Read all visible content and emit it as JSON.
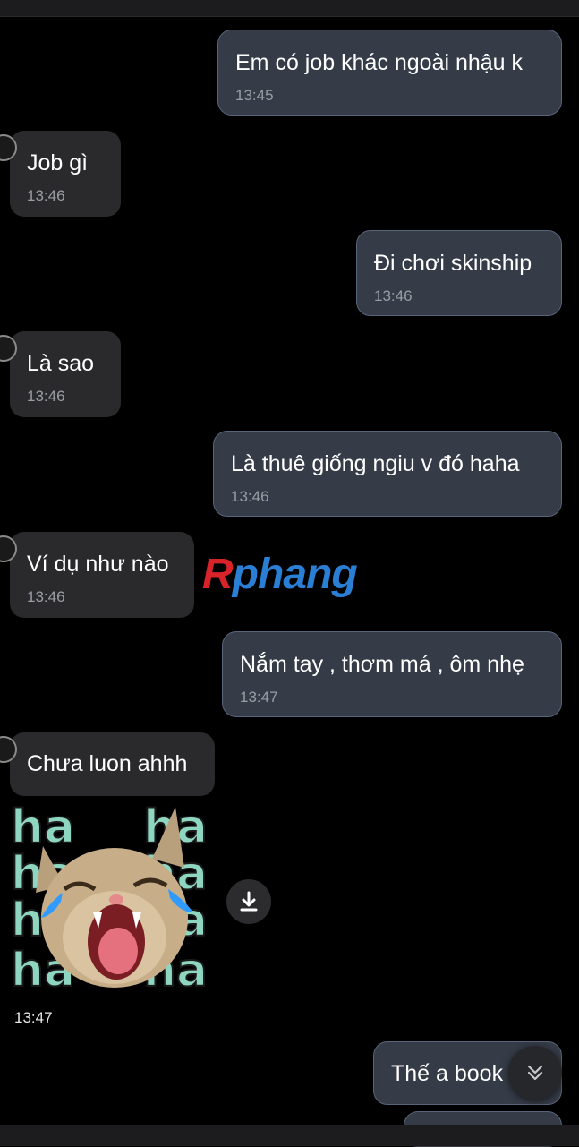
{
  "messages": [
    {
      "side": "sent",
      "text": "Em có job khác ngoài nhậu k",
      "time": "13:45"
    },
    {
      "side": "recv",
      "text": "Job gì",
      "time": "13:46"
    },
    {
      "side": "sent",
      "text": "Đi chơi skinship",
      "time": "13:46"
    },
    {
      "side": "recv",
      "text": "Là sao",
      "time": "13:46"
    },
    {
      "side": "sent",
      "text": "Là thuê giống ngiu v đó haha",
      "time": "13:46"
    },
    {
      "side": "recv",
      "text": "Ví dụ như nào",
      "time": "13:46"
    },
    {
      "side": "sent",
      "text": "Nắm tay , thơm má , ôm nhẹ",
      "time": "13:47"
    },
    {
      "side": "recv",
      "text": "Chưa luon ahhh",
      "time": ""
    },
    {
      "side": "sent",
      "text": "Thế a book",
      "time": ""
    }
  ],
  "watermark": {
    "first": "R",
    "rest": "phang"
  },
  "sticker": {
    "caption": "ha",
    "time": "13:47",
    "icon": "download-icon"
  },
  "scroll_button": {
    "icon": "chevron-double-down-icon"
  },
  "colors": {
    "background": "#000000",
    "received_bubble": "#2a2a2c",
    "sent_bubble": "#353b47",
    "sent_border": "#58647a",
    "timestamp": "#9a9da3"
  }
}
